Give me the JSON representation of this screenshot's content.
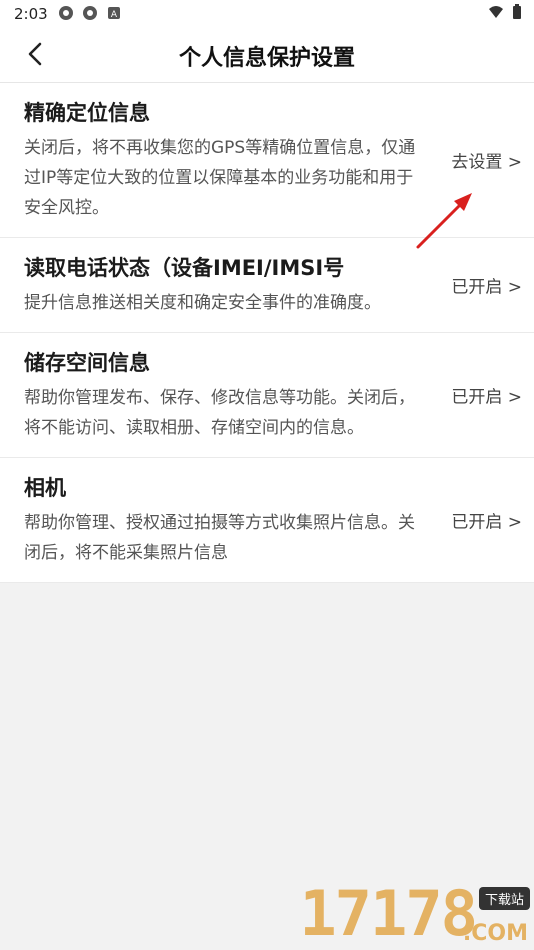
{
  "status_bar": {
    "time": "2:03",
    "icons": [
      "app-notification-icon",
      "app-notification-icon",
      "a-icon",
      "wifi-icon",
      "battery-icon"
    ]
  },
  "header": {
    "title": "个人信息保护设置",
    "back_icon": "chevron-left-icon"
  },
  "items": [
    {
      "title": "精确定位信息",
      "desc": "关闭后，将不再收集您的GPS等精确位置信息，仅通过IP等定位大致的位置以保障基本的业务功能和用于安全风控。",
      "action": "去设置 >"
    },
    {
      "title": "读取电话状态（设备IMEI/IMSI号",
      "desc": "提升信息推送相关度和确定安全事件的准确度。",
      "action": "已开启 >"
    },
    {
      "title": "储存空间信息",
      "desc": "帮助你管理发布、保存、修改信息等功能。关闭后，将不能访问、读取相册、存储空间内的信息。",
      "action": "已开启 >"
    },
    {
      "title": "相机",
      "desc": "帮助你管理、授权通过拍摄等方式收集照片信息。关闭后，将不能采集照片信息",
      "action": "已开启 >"
    }
  ],
  "watermark": {
    "number": "17178",
    "badge": "下载站",
    "domain": ".COM"
  },
  "colors": {
    "annotation_arrow": "#d9201e",
    "watermark": "#e2a84b"
  }
}
